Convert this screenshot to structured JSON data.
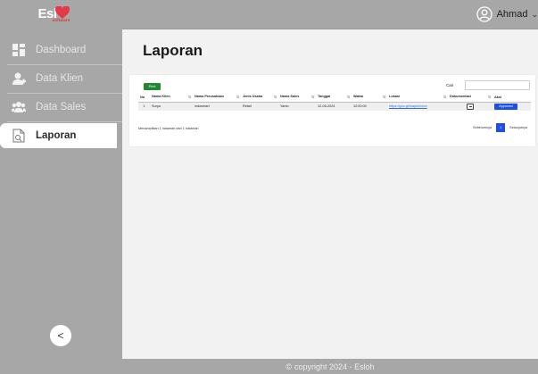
{
  "logo": {
    "text": "Esl",
    "tag": "software"
  },
  "header": {
    "user_name": "Ahmad"
  },
  "sidebar": {
    "items": [
      {
        "label": "Dashboard",
        "icon": "dashboard-icon",
        "active": false
      },
      {
        "label": "Data Klien",
        "icon": "user-icon",
        "active": false
      },
      {
        "label": "Data Sales",
        "icon": "users-group-icon",
        "active": false
      },
      {
        "label": "Laporan",
        "icon": "report-icon",
        "active": true
      }
    ],
    "collapse_label": "<"
  },
  "main": {
    "title": "Laporan",
    "print_label": "Print",
    "search_label": "Cari",
    "search_value": ""
  },
  "table": {
    "headers": [
      "No",
      "Nama Klien",
      "Nama Perusahaan",
      "Jenis Usaha",
      "Nama Sales",
      "Tanggal",
      "Waktu",
      "Lokasi",
      "Dokumentasi",
      "Aksi"
    ],
    "rows": [
      {
        "no": "1",
        "nama_klien": "Surya",
        "nama_perusahaan": "indosmart",
        "jenis_usaha": "Retail",
        "nama_sales": "Yanto",
        "tanggal": "12-05-2024",
        "waktu": "12:00:00",
        "lokasi": "https://goo.gl/maps/xxxxx",
        "aksi": "Approved"
      }
    ]
  },
  "pagination": {
    "info": "Menampilkan 1 halaman dari 1 halaman",
    "prev": "Sebelumnya",
    "current": "1",
    "next": "Selanjutnya"
  },
  "footer": {
    "copyright": "copyright 2024 - Esloh"
  },
  "colors": {
    "sidebar": "#a7a7a7",
    "print": "#1f8a2f",
    "primary": "#1f4fe0",
    "link": "#2f6fd8"
  }
}
